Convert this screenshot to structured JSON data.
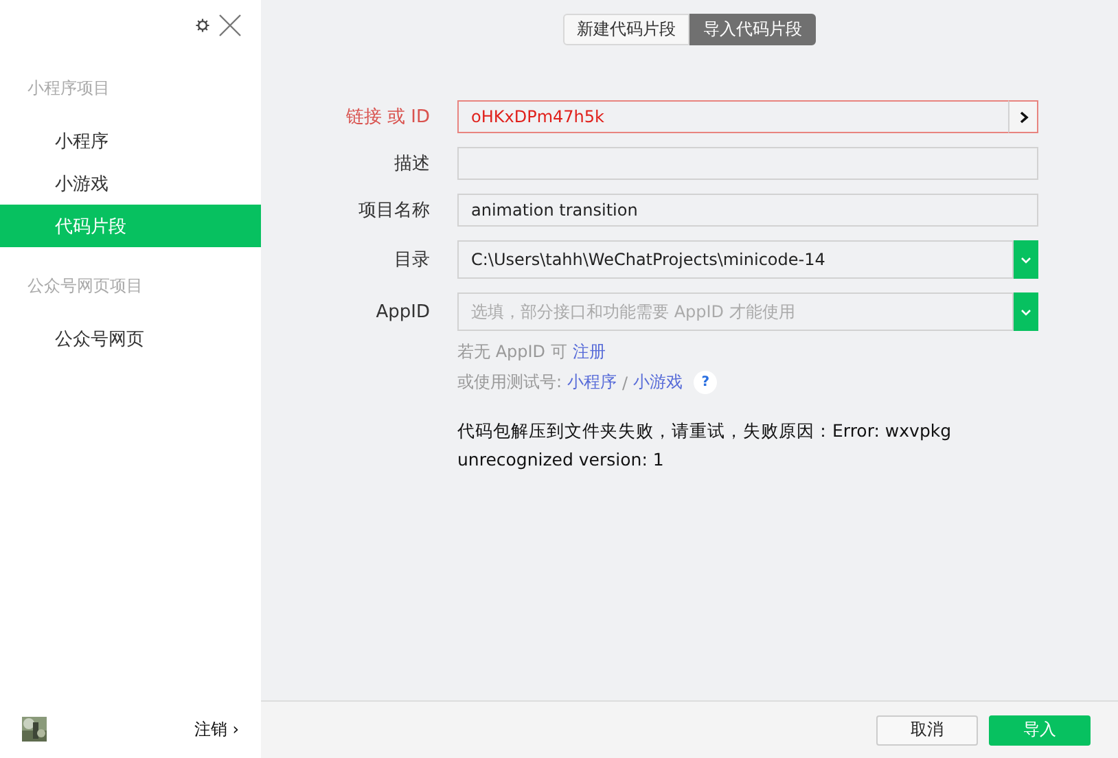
{
  "sidebar": {
    "sections": [
      {
        "title": "小程序项目",
        "items": [
          {
            "label": "小程序",
            "selected": false
          },
          {
            "label": "小游戏",
            "selected": false
          },
          {
            "label": "代码片段",
            "selected": true
          }
        ]
      },
      {
        "title": "公众号网页项目",
        "items": [
          {
            "label": "公众号网页",
            "selected": false
          }
        ]
      }
    ],
    "logout": "注销 ›"
  },
  "tabs": [
    {
      "label": "新建代码片段",
      "selected": false
    },
    {
      "label": "导入代码片段",
      "selected": true
    }
  ],
  "fields": [
    {
      "label": "链接 或 ID",
      "kind": "link",
      "value": "oHKxDPm47h5k",
      "error": true
    },
    {
      "label": "描述",
      "kind": "text",
      "error": false
    },
    {
      "label": "项目名称",
      "kind": "text",
      "value": "animation transition",
      "error": false
    },
    {
      "label": "目录",
      "kind": "select",
      "value": "C:\\Users\\tahh\\WeChatProjects\\minicode-14",
      "error": false
    },
    {
      "label": "AppID",
      "kind": "select",
      "placeholder": "选填，部分接口和功能需要 AppID 才能使用",
      "error": false
    }
  ],
  "hint": {
    "register_text": "若无 AppID 可",
    "register_link": "注册",
    "test_text": "或使用测试号:",
    "test_links": [
      "小程序",
      "小游戏"
    ],
    "separator": "/",
    "help": "?"
  },
  "error_message": "代码包解压到文件夹失败，请重试，失败原因：Error: wxvpkg unrecognized version: 1",
  "buttons": {
    "cancel": "取消",
    "confirm": "导入"
  }
}
